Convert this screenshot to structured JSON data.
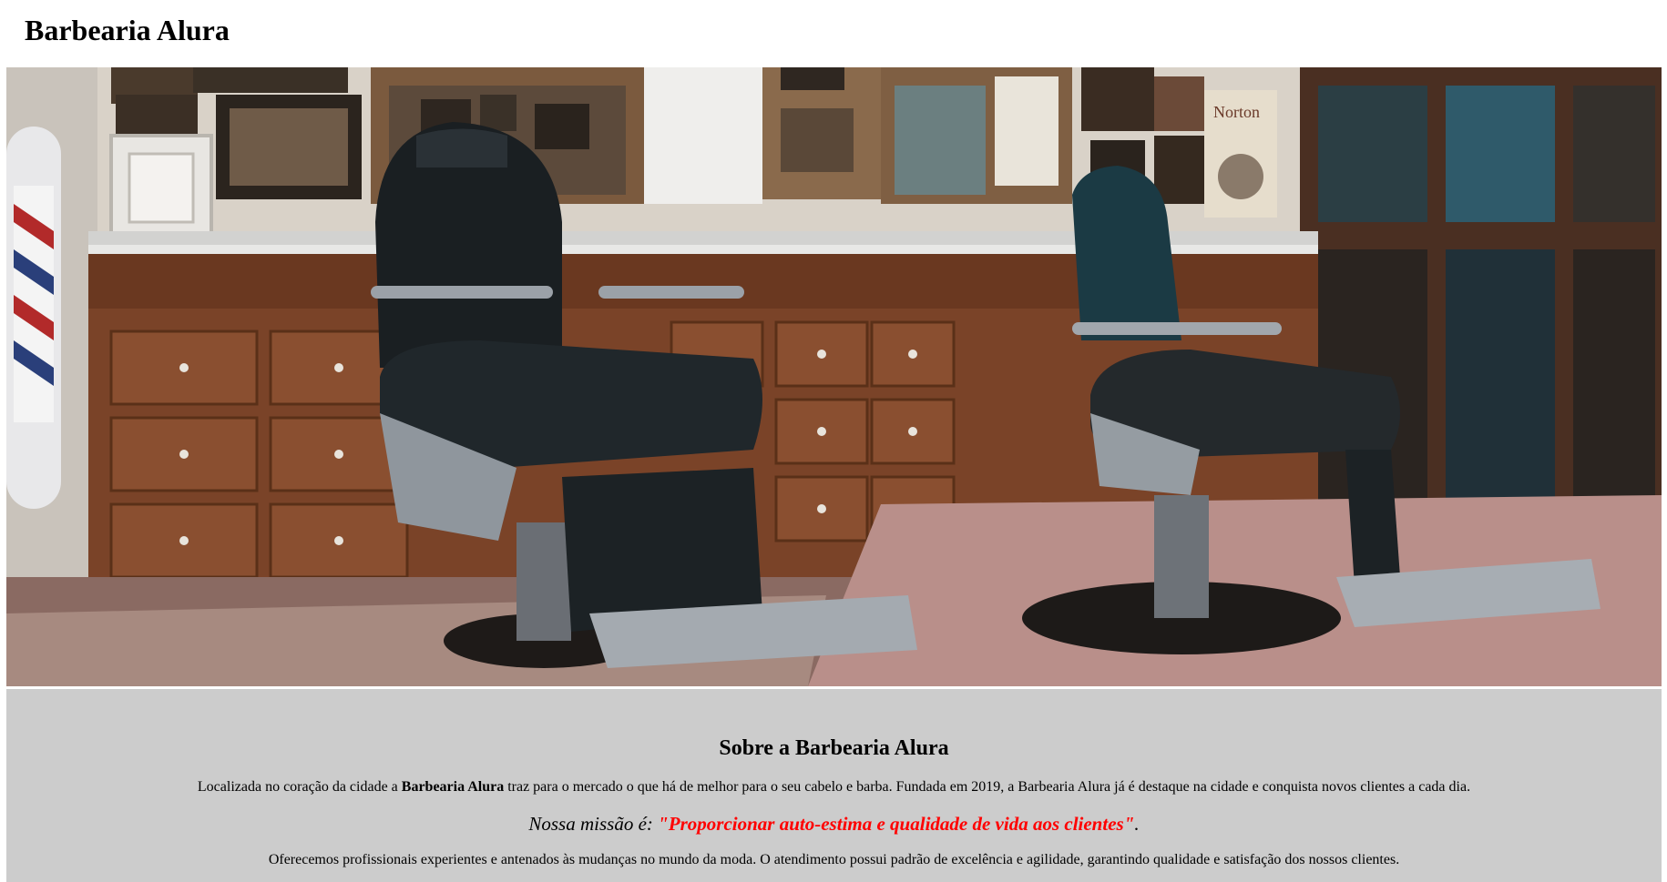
{
  "header": {
    "title": "Barbearia Alura"
  },
  "hero": {
    "image": "barbershop-interior-photo",
    "sign_text": "Norton"
  },
  "about": {
    "heading": "Sobre a Barbearia Alura",
    "paragraph_before": "Localizada no coração da cidade a ",
    "paragraph_strong": "Barbearia Alura",
    "paragraph_after": " traz para o mercado o que há de melhor para o seu cabelo e barba. Fundada em 2019, a Barbearia Alura já é destaque na cidade e conquista novos clientes a cada dia.",
    "mission_label": "Nossa missão é: ",
    "mission_quote": "\"Proporcionar auto-estima e qualidade de vida aos clientes\"",
    "mission_end": ".",
    "services": "Oferecemos profissionais experientes e antenados às mudanças no mundo da moda. O atendimento possui padrão de excelência e agilidade, garantindo qualidade e satisfação dos nossos clientes."
  },
  "colors": {
    "section_background": "#cccccc",
    "mission_highlight": "#ff0000"
  }
}
